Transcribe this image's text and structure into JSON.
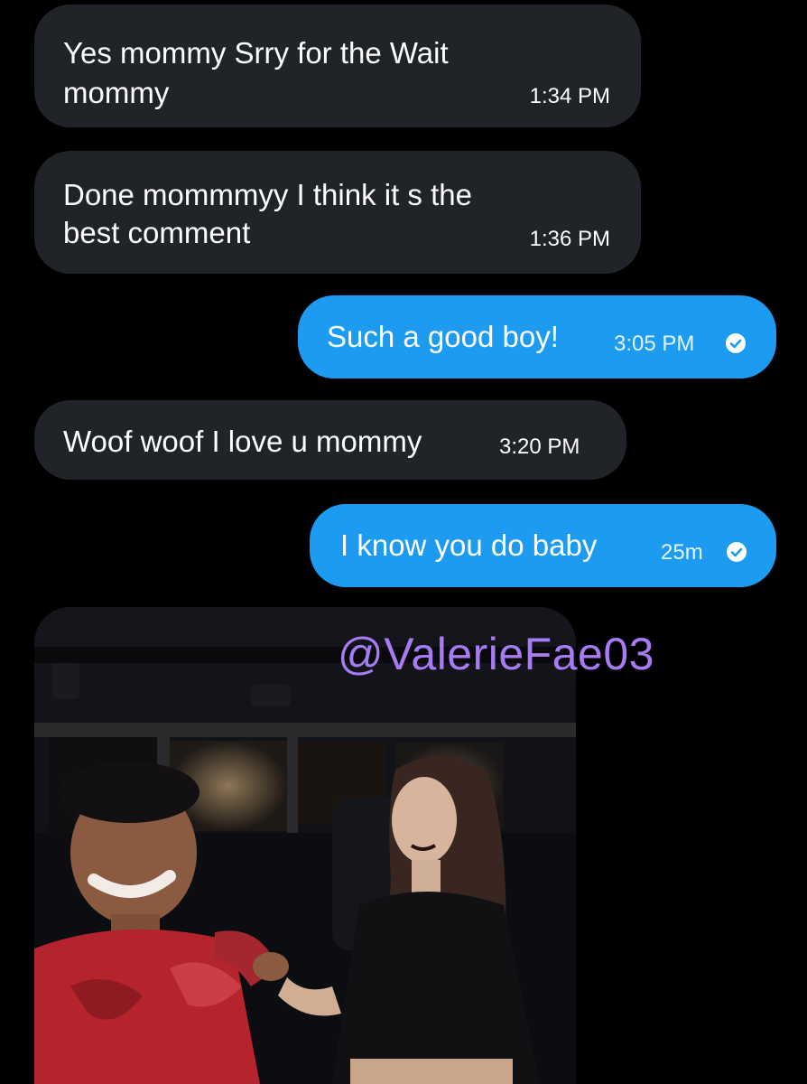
{
  "messages": [
    {
      "direction": "incoming",
      "text_line1": "Yes mommy Srry for the Wait",
      "text_line2": "mommy",
      "time": "1:34 PM"
    },
    {
      "direction": "incoming",
      "text_line1": "Done mommmyy I think it s the",
      "text_line2": "best comment",
      "time": "1:36 PM"
    },
    {
      "direction": "outgoing",
      "text": "Such a good boy!",
      "time": "3:05 PM",
      "status_icon": "check-circle-icon"
    },
    {
      "direction": "incoming",
      "text": "Woof woof I love u mommy",
      "time": "3:20 PM"
    },
    {
      "direction": "outgoing",
      "text": "I know you do baby",
      "time": "25m",
      "status_icon": "check-circle-icon"
    }
  ],
  "media": {
    "watermark": "@ValerieFae03",
    "watermark_color": "#a77bf3"
  },
  "colors": {
    "background": "#000000",
    "incoming_bubble": "#202327",
    "outgoing_bubble": "#1d9bf0"
  }
}
